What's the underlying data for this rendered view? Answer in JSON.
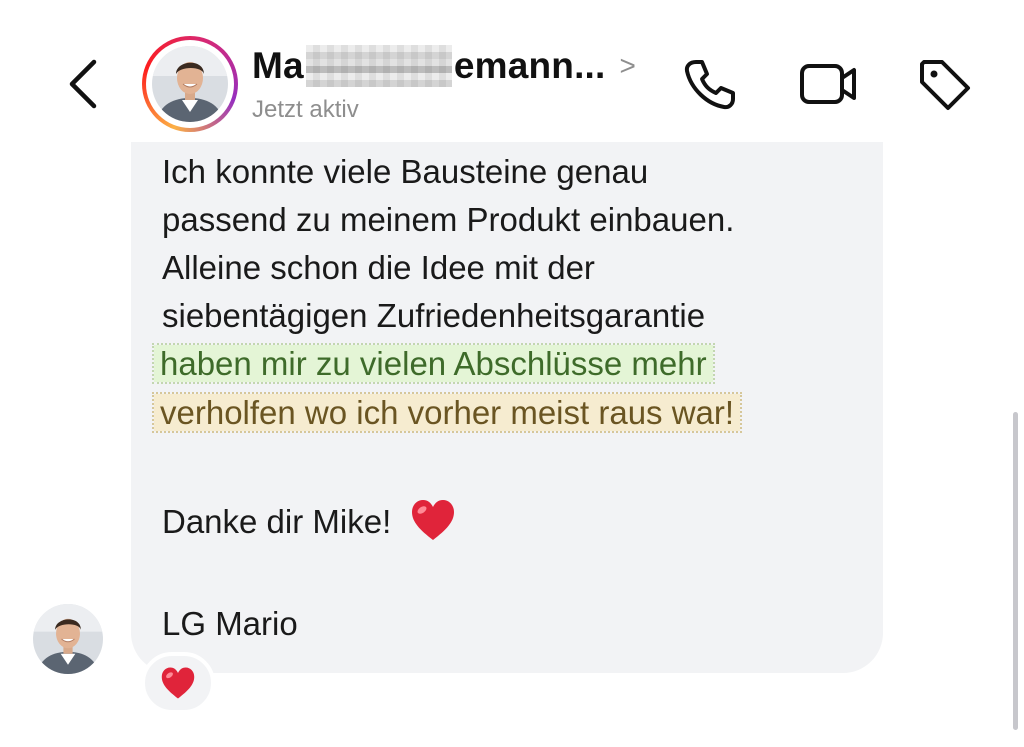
{
  "header": {
    "contact_name_start": "Ma",
    "contact_name_end": "emann...",
    "name_chevron": ">",
    "status": "Jetzt aktiv",
    "icons": {
      "back": "chevron-left-icon",
      "phone": "phone-icon",
      "video": "video-camera-icon",
      "tag": "tag-icon"
    }
  },
  "message": {
    "lines": [
      "Ich konnte viele Bausteine genau",
      "passend zu meinem Produkt einbauen.",
      "Alleine schon die Idee mit der",
      "siebentägigen Zufriedenheitsgarantie"
    ],
    "highlight_green": "haben mir zu vielen Abschlüsse mehr",
    "highlight_yellow": "verholfen wo ich vorher meist raus war!",
    "thanks": "Danke dir Mike!",
    "signature": "LG Mario"
  },
  "reaction": {
    "emoji": "heart-icon"
  },
  "colors": {
    "bubble": "#f2f3f5",
    "highlight_green_bg": "#e4f5d6",
    "highlight_yellow_bg": "#f6ecd0",
    "status_gray": "#8e8e8e",
    "heart_red": "#e0243a"
  }
}
